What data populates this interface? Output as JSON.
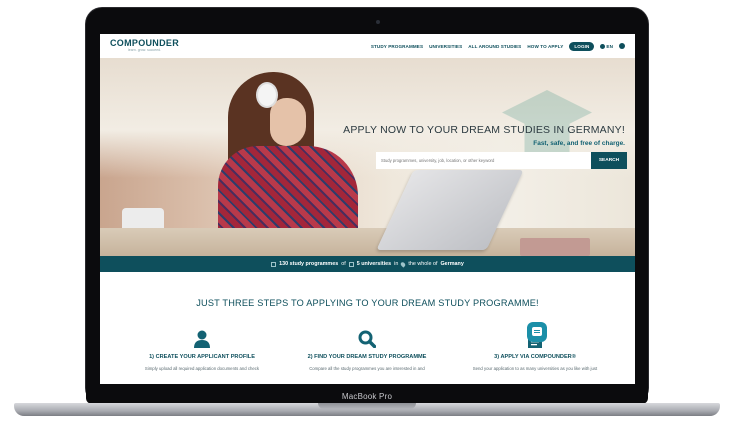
{
  "device": {
    "model_label": "MacBook Pro"
  },
  "nav": {
    "logo": "COMPOUNDER",
    "logo_tagline": "learn. grow. succeed.",
    "items": [
      "STUDY PROGRAMMES",
      "UNIVERSITIES",
      "ALL AROUND STUDIES",
      "HOW TO APPLY"
    ],
    "login_label": "LOGIN",
    "language": "EN"
  },
  "hero": {
    "title": "APPLY NOW TO YOUR DREAM STUDIES IN GERMANY!",
    "subtitle": "Fast, safe, and free of charge.",
    "search_placeholder": "Study programmes, university, job, location, or other keyword",
    "search_button": "SEARCH"
  },
  "stats": {
    "programmes": "130 study programmes",
    "of": "of",
    "universities": "5 universities",
    "in": "in",
    "whole_of": "the whole of",
    "country": "Germany"
  },
  "steps_section": {
    "title": "JUST THREE STEPS TO APPLYING TO YOUR DREAM STUDY PROGRAMME!",
    "steps": [
      {
        "icon": "user-icon",
        "title": "1) CREATE YOUR APPLICANT PROFILE",
        "desc": "Simply upload all required application documents and check"
      },
      {
        "icon": "search-icon",
        "title": "2) FIND YOUR DREAM STUDY PROGRAMME",
        "desc": "Compare all the study programmes you are interested in and"
      },
      {
        "icon": "document-icon",
        "title": "3) APPLY VIA COMPOUNDER®",
        "desc": "Send your application to as many universities as you like with just"
      }
    ]
  },
  "colors": {
    "brand": "#0e4f5c",
    "accent": "#1b8fa8"
  }
}
